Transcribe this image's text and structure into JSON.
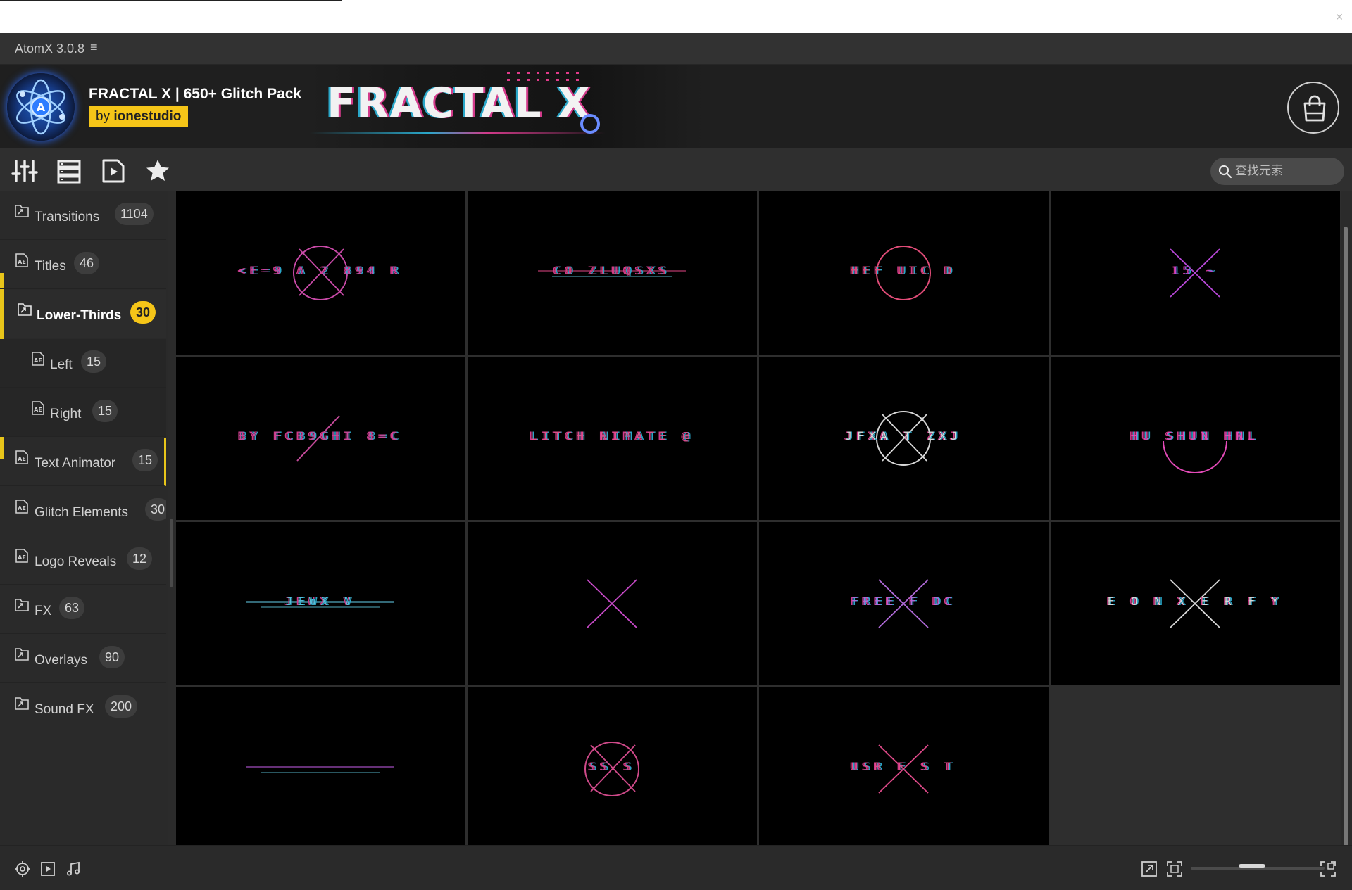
{
  "app": {
    "title": "AtomX 3.0.8",
    "menu_icon": "menu-icon",
    "close_icon": "close-icon"
  },
  "banner": {
    "pack_title": "FRACTAL X | 650+ Glitch Pack",
    "author_prefix": "by",
    "author_name": "ionestudio",
    "brand_text": "FRACTAL X",
    "cart_icon": "shopping-bag-icon",
    "accent": "#f5c518"
  },
  "toolbar": {
    "icons": [
      "sliders-icon",
      "list-icon",
      "play-file-icon",
      "star-icon"
    ],
    "search_placeholder": "查找元素"
  },
  "sidebar": {
    "items": [
      {
        "label": "Transitions",
        "count": "1104",
        "icon": "folder-link-icon"
      },
      {
        "label": "Titles",
        "count": "46",
        "icon": "ae-file-icon"
      },
      {
        "label": "Lower-Thirds",
        "count": "30",
        "icon": "folder-link-icon",
        "active": true
      },
      {
        "label": "Left",
        "count": "15",
        "icon": "ae-file-icon",
        "sub": true
      },
      {
        "label": "Right",
        "count": "15",
        "icon": "ae-file-icon",
        "sub": true
      },
      {
        "label": "Text Animator",
        "count": "15",
        "icon": "ae-file-icon"
      },
      {
        "label": "Glitch Elements",
        "count": "30",
        "icon": "ae-file-icon"
      },
      {
        "label": "Logo Reveals",
        "count": "12",
        "icon": "ae-file-icon"
      },
      {
        "label": "FX",
        "count": "63",
        "icon": "folder-link-icon"
      },
      {
        "label": "Overlays",
        "count": "90",
        "icon": "folder-link-icon"
      },
      {
        "label": "Sound FX",
        "count": "200",
        "icon": "folder-link-icon"
      }
    ]
  },
  "grid": {
    "thumbnails": [
      {
        "text": "<E=9 A  2 894 R",
        "shape": "circle-x",
        "color": "#c94aa8"
      },
      {
        "text": "CO ZLUQSXS",
        "shape": "glitch",
        "color": "#d0407a"
      },
      {
        "text": "HEF UIC  D",
        "shape": "circle",
        "color": "#e14c78"
      },
      {
        "text": "15 ~  ",
        "shape": "x",
        "color": "#b848d8"
      },
      {
        "text": "BY FCB9GHI 8=C",
        "shape": "slash",
        "color": "#c54a9a"
      },
      {
        "text": "LITCH  NIMATE @",
        "shape": "none",
        "color": "#e0508a"
      },
      {
        "text": "JFXA  T  ZXJ",
        "shape": "circle-x",
        "color": "#d8d8d8"
      },
      {
        "text": "HU  SHUN HNL",
        "shape": "arc",
        "color": "#e44ab8"
      },
      {
        "text": "JEWX V",
        "shape": "glitch",
        "color": "#5cc0d8"
      },
      {
        "text": "   ",
        "shape": "x",
        "color": "#c84ac8"
      },
      {
        "text": "FREE F  DC",
        "shape": "x",
        "color": "#b06ad8"
      },
      {
        "text": "E O N  X E R  F Y",
        "shape": "x",
        "color": "#d8d8d8"
      },
      {
        "text": "   ",
        "shape": "glitch",
        "color": "#b858d8"
      },
      {
        "text": "SS     S",
        "shape": "circle-x",
        "color": "#d04a8a"
      },
      {
        "text": "USR  E  S  T",
        "shape": "x",
        "color": "#e04a8a"
      }
    ]
  },
  "bottombar": {
    "left_icons": [
      "camera-settings-icon",
      "video-icon",
      "music-icon"
    ],
    "right_icons": [
      "expand-icon",
      "fit-screen-icon",
      "fullscreen-icon"
    ],
    "zoom_level": 0.45
  }
}
